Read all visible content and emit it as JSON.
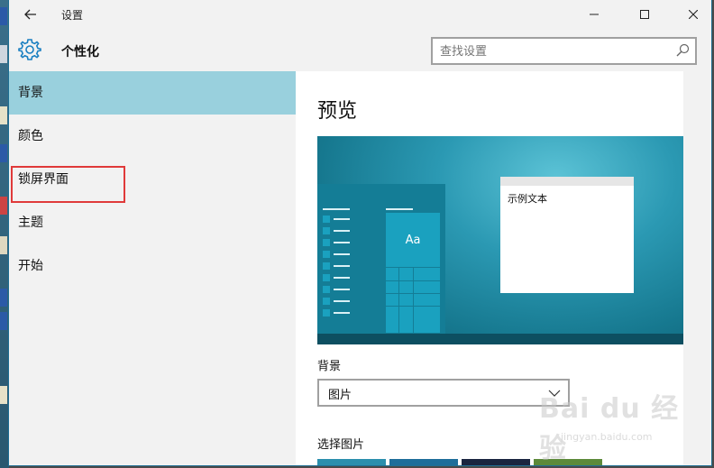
{
  "window": {
    "title": "设置",
    "header_title": "个性化"
  },
  "search": {
    "placeholder": "查找设置"
  },
  "sidebar": {
    "items": [
      {
        "label": "背景",
        "selected": true
      },
      {
        "label": "颜色",
        "selected": false
      },
      {
        "label": "锁屏界面",
        "selected": false,
        "highlighted": true
      },
      {
        "label": "主题",
        "selected": false
      },
      {
        "label": "开始",
        "selected": false
      }
    ]
  },
  "main": {
    "preview_heading": "预览",
    "preview_tile_text": "Aa",
    "preview_sample_text": "示例文本",
    "background_label": "背景",
    "background_value": "图片",
    "choose_picture_label": "选择图片"
  },
  "watermark": {
    "logo": "Bai du 经验",
    "url": "jingyan.baidu.com"
  },
  "colors": {
    "accent": "#99d0dd",
    "highlight_border": "#e03a3a",
    "window_border": "#1f6f93"
  },
  "icons": {
    "back": "back-arrow-icon",
    "minimize": "minimize-icon",
    "maximize": "maximize-icon",
    "close": "close-icon",
    "settings": "gear-icon",
    "search": "search-icon",
    "dropdown": "chevron-down-icon"
  }
}
